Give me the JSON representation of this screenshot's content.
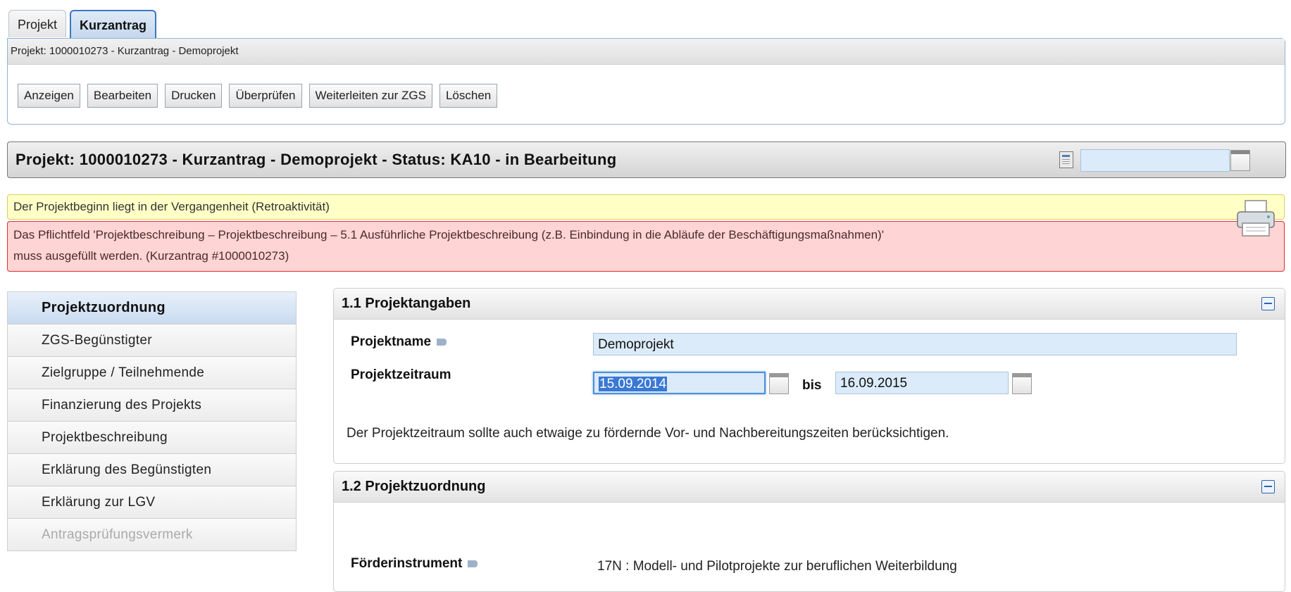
{
  "tabs": [
    {
      "label": "Projekt",
      "active": false
    },
    {
      "label": "Kurzantrag",
      "active": true
    }
  ],
  "header": {
    "breadcrumb": "Projekt: 1000010273 - Kurzantrag - Demoprojekt",
    "buttons": [
      "Anzeigen",
      "Bearbeiten",
      "Drucken",
      "Überprüfen",
      "Weiterleiten zur ZGS",
      "Löschen"
    ]
  },
  "title": {
    "text": "Projekt: 1000010273 - Kurzantrag - Demoprojekt - Status: KA10 - in Bearbeitung",
    "search_value": ""
  },
  "messages": {
    "warning": "Der Projektbeginn liegt in der Vergangenheit (Retroaktivität)",
    "error_line1": "Das Pflichtfeld 'Projektbeschreibung – Projektbeschreibung – 5.1 Ausführliche Projektbeschreibung (z.B. Einbindung in die Abläufe der Beschäftigungsmaßnahmen)'",
    "error_line2": "muss ausgefüllt werden. (Kurzantrag #1000010273)"
  },
  "sidebar": {
    "items": [
      {
        "label": "Projektzuordnung",
        "state": "active"
      },
      {
        "label": "ZGS-Begünstigter",
        "state": "normal"
      },
      {
        "label": "Zielgruppe / Teilnehmende",
        "state": "normal"
      },
      {
        "label": "Finanzierung des Projekts",
        "state": "normal"
      },
      {
        "label": "Projektbeschreibung",
        "state": "normal"
      },
      {
        "label": "Erklärung des Begünstigten",
        "state": "normal"
      },
      {
        "label": "Erklärung zur LGV",
        "state": "normal"
      },
      {
        "label": "Antragsprüfungsvermerk",
        "state": "disabled"
      }
    ]
  },
  "section1": {
    "title": "1.1 Projektangaben",
    "projektname_label": "Projektname",
    "projektname_value": "Demoprojekt",
    "zeitraum_label": "Projektzeitraum",
    "date_from": "15.09.2014",
    "bis_label": "bis",
    "date_to": "16.09.2015",
    "hint": "Der Projektzeitraum sollte auch etwaige zu fördernde Vor- und Nachbereitungszeiten berücksichtigen."
  },
  "section2": {
    "title": "1.2 Projektzuordnung",
    "foerder_label": "Förderinstrument",
    "foerder_value": "17N : Modell- und Pilotprojekte zur beruflichen Weiterbildung"
  },
  "colors": {
    "accent": "#3b78c2",
    "warning_bg": "#ffffc6",
    "error_bg": "#ffd4d4",
    "error_border": "#e03030",
    "input_bg": "#dcebf9"
  },
  "icons": {
    "title_icon": "form-icon",
    "calendar": "calendar-icon",
    "printer": "printer-icon",
    "help": "help-icon",
    "collapse": "collapse-icon"
  }
}
